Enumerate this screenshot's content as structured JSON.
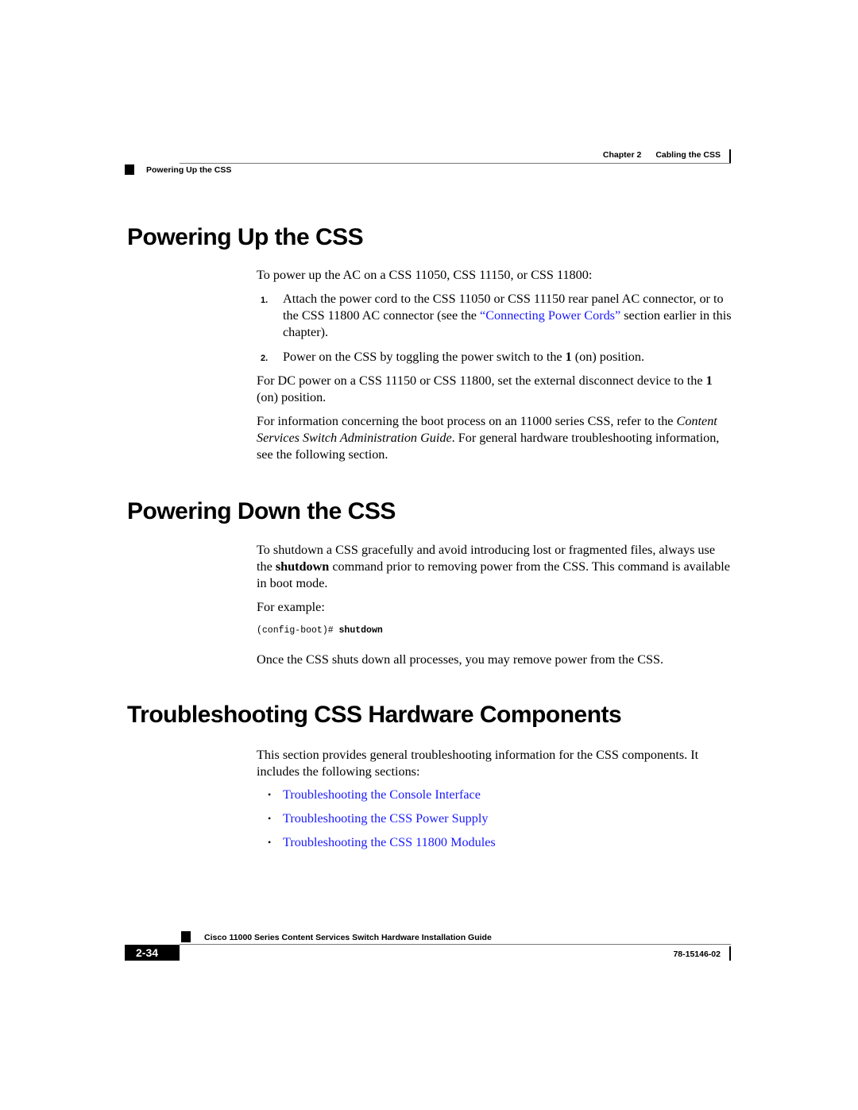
{
  "header": {
    "chapter": "Chapter 2",
    "chapter_title": "Cabling the CSS",
    "section": "Powering Up the CSS"
  },
  "sections": {
    "power_up": {
      "title": "Powering Up the CSS",
      "intro": "To power up the AC on a CSS 11050, CSS 11150, or CSS 11800:",
      "steps": [
        {
          "num": "1.",
          "text_before": "Attach the power cord to the CSS 11050 or CSS 11150 rear panel AC connector, or to the CSS 11800 AC connector (see the ",
          "link": "“Connecting Power Cords”",
          "text_after": " section earlier in this chapter)."
        },
        {
          "num": "2.",
          "text_before": "Power on the CSS by toggling the power switch to the ",
          "bold": "1",
          "text_after": " (on) position."
        }
      ],
      "dc_para": {
        "before": "For DC power on a CSS 11150 or CSS 11800, set the external disconnect device to the ",
        "bold": "1",
        "after": " (on) position."
      },
      "boot_para": {
        "before": "For information concerning the boot process on an 11000 series CSS, refer to the ",
        "italic": "Content Services Switch Administration Guide",
        "after": ". For general hardware troubleshooting information, see the following section."
      }
    },
    "power_down": {
      "title": "Powering Down the CSS",
      "para": {
        "before": "To shutdown a CSS gracefully and avoid introducing lost or fragmented files, always use the ",
        "bold": "shutdown",
        "after": " command prior to removing power from the CSS. This command is available in boot mode."
      },
      "example_label": "For example:",
      "code_prompt": "(config-boot)# ",
      "code_command": "shutdown",
      "closing": "Once the CSS shuts down all processes, you may remove power from the CSS."
    },
    "troubleshooting": {
      "title": "Troubleshooting CSS Hardware Components",
      "intro": "This section provides general troubleshooting information for the CSS components. It includes the following sections:",
      "bullet_glyph": "•",
      "links": [
        "Troubleshooting the Console Interface",
        "Troubleshooting the CSS Power Supply",
        "Troubleshooting the CSS 11800 Modules"
      ]
    }
  },
  "footer": {
    "guide_title": "Cisco 11000 Series Content Services Switch Hardware Installation Guide",
    "page_number": "2-34",
    "doc_number": "78-15146-02"
  },
  "colors": {
    "link": "#1a1aff",
    "text": "#000000"
  }
}
